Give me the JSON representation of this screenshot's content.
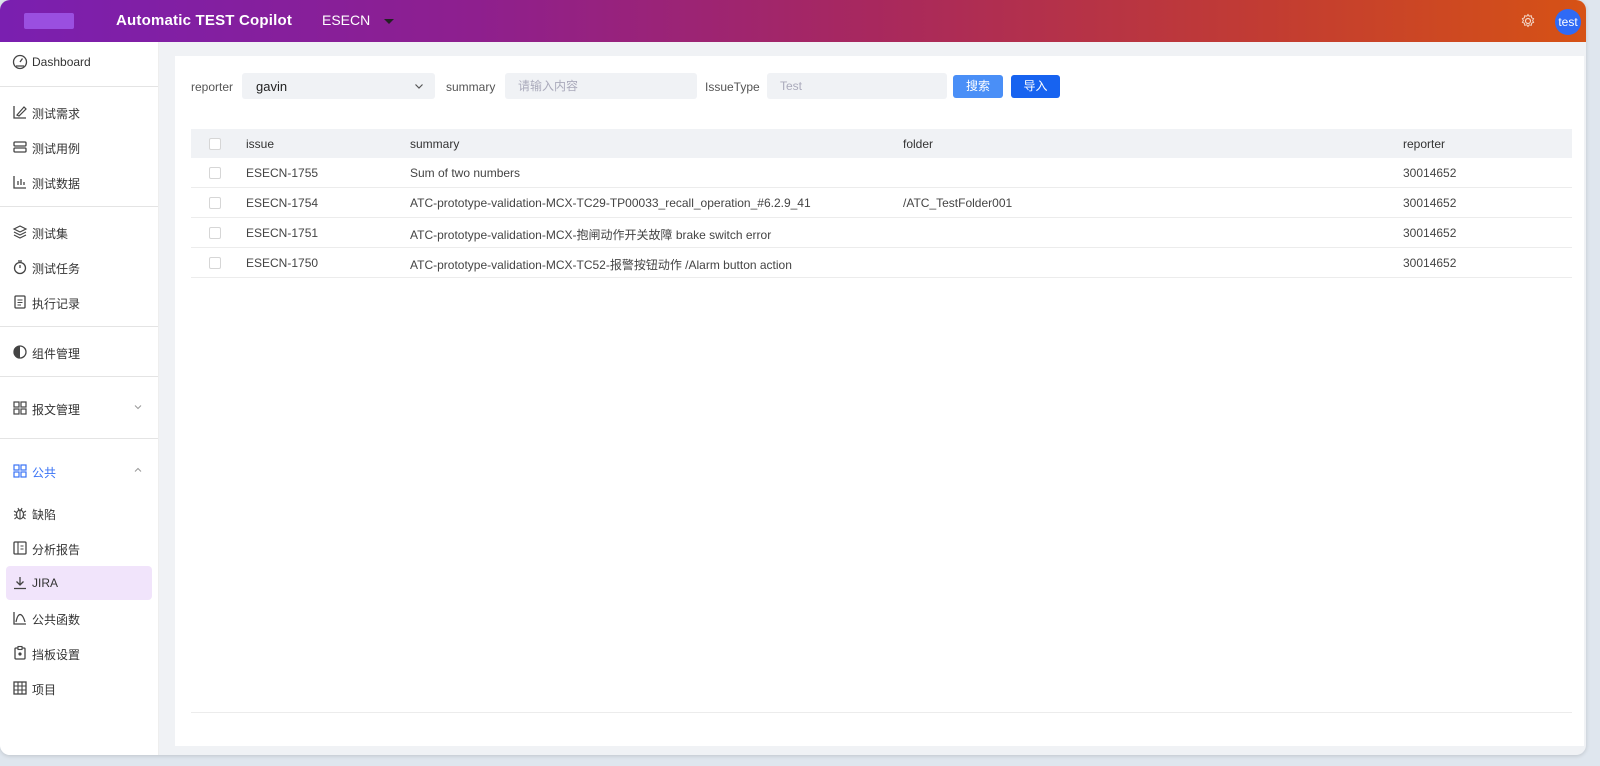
{
  "header": {
    "title": "Automatic TEST Copilot",
    "project": "ESECN",
    "avatar_text": "test",
    "settings_icon": "gear-icon",
    "gradient": [
      "#7a1fb0",
      "#d65215"
    ]
  },
  "sidebar": {
    "items": [
      {
        "label": "Dashboard",
        "icon": "dashboard-icon"
      },
      {
        "label": "测试需求",
        "icon": "edit-icon"
      },
      {
        "label": "测试用例",
        "icon": "cases-icon"
      },
      {
        "label": "测试数据",
        "icon": "chart-icon"
      },
      {
        "label": "测试集",
        "icon": "layers-icon"
      },
      {
        "label": "测试任务",
        "icon": "timer-icon"
      },
      {
        "label": "执行记录",
        "icon": "document-icon"
      },
      {
        "label": "组件管理",
        "icon": "component-icon"
      },
      {
        "label": "报文管理",
        "icon": "grid-icon"
      },
      {
        "label": "公共",
        "icon": "grid-icon"
      },
      {
        "label": "缺陷",
        "icon": "bug-icon"
      },
      {
        "label": "分析报告",
        "icon": "report-icon"
      },
      {
        "label": "JIRA",
        "icon": "download-icon"
      },
      {
        "label": "公共函数",
        "icon": "function-icon"
      },
      {
        "label": "挡板设置",
        "icon": "clipboard-icon"
      },
      {
        "label": "项目",
        "icon": "table-icon"
      }
    ],
    "accent": "#3a73f5",
    "active_bg": "#f1e4fb"
  },
  "filters": {
    "reporter_label": "reporter",
    "reporter_value": "gavin",
    "summary_label": "summary",
    "summary_placeholder": "请输入内容",
    "issuetype_label": "IssueType",
    "issuetype_placeholder": "Test",
    "search_button": "搜索",
    "import_button": "导入"
  },
  "table": {
    "columns": [
      "issue",
      "summary",
      "folder",
      "reporter"
    ],
    "rows": [
      {
        "issue": "ESECN-1755",
        "summary": "Sum of two numbers",
        "folder": "",
        "reporter": "30014652"
      },
      {
        "issue": "ESECN-1754",
        "summary": "ATC-prototype-validation-MCX-TC29-TP00033_recall_operation_#6.2.9_41",
        "folder": "/ATC_TestFolder001",
        "reporter": "30014652"
      },
      {
        "issue": "ESECN-1751",
        "summary": "ATC-prototype-validation-MCX-抱闸动作开关故障 brake switch error",
        "folder": "",
        "reporter": "30014652"
      },
      {
        "issue": "ESECN-1750",
        "summary": "ATC-prototype-validation-MCX-TC52-报警按钮动作 /Alarm button action",
        "folder": "",
        "reporter": "30014652"
      }
    ]
  }
}
